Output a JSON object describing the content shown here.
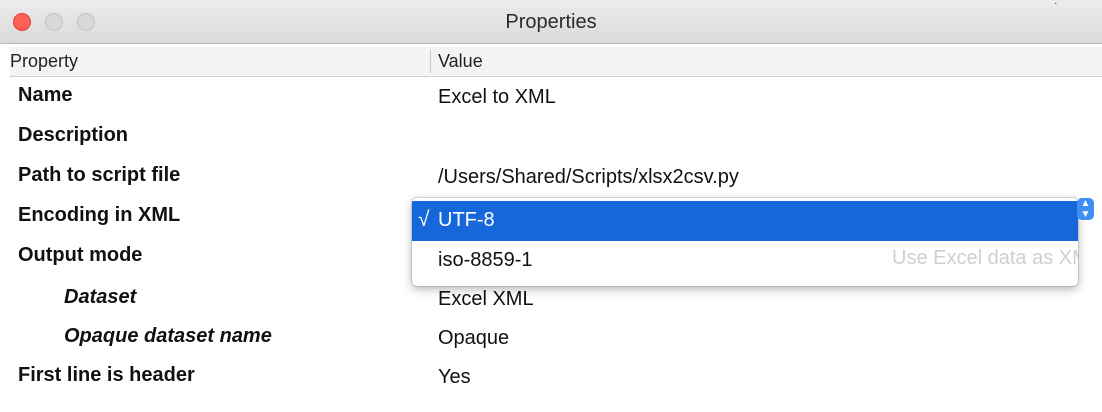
{
  "window": {
    "title": "Properties"
  },
  "table": {
    "col_property": "Property",
    "col_value": "Value"
  },
  "rows": [
    {
      "name": "Name",
      "value": "Excel to XML"
    },
    {
      "name": "Description",
      "value": ""
    },
    {
      "name": "Path to script file",
      "value": "/Users/Shared/Scripts/xlsx2csv.py"
    },
    {
      "name": "Encoding in XML",
      "value": ""
    },
    {
      "name": "Output mode",
      "value": ""
    },
    {
      "name": "Dataset",
      "value": "Excel XML"
    },
    {
      "name": "Opaque dataset name",
      "value": "Opaque"
    },
    {
      "name": "First line is header",
      "value": "Yes"
    }
  ],
  "encoding_dropdown": {
    "selected": "UTF-8",
    "check_glyph": "√",
    "options": [
      "UTF-8",
      "iso-8859-1"
    ],
    "obscured_text": "Use Excel data as XML dataset"
  },
  "colors": {
    "accent": "#1667d9",
    "close_button": "#fe5f57"
  },
  "icons": {
    "stepper": "up-down-stepper-icon"
  }
}
